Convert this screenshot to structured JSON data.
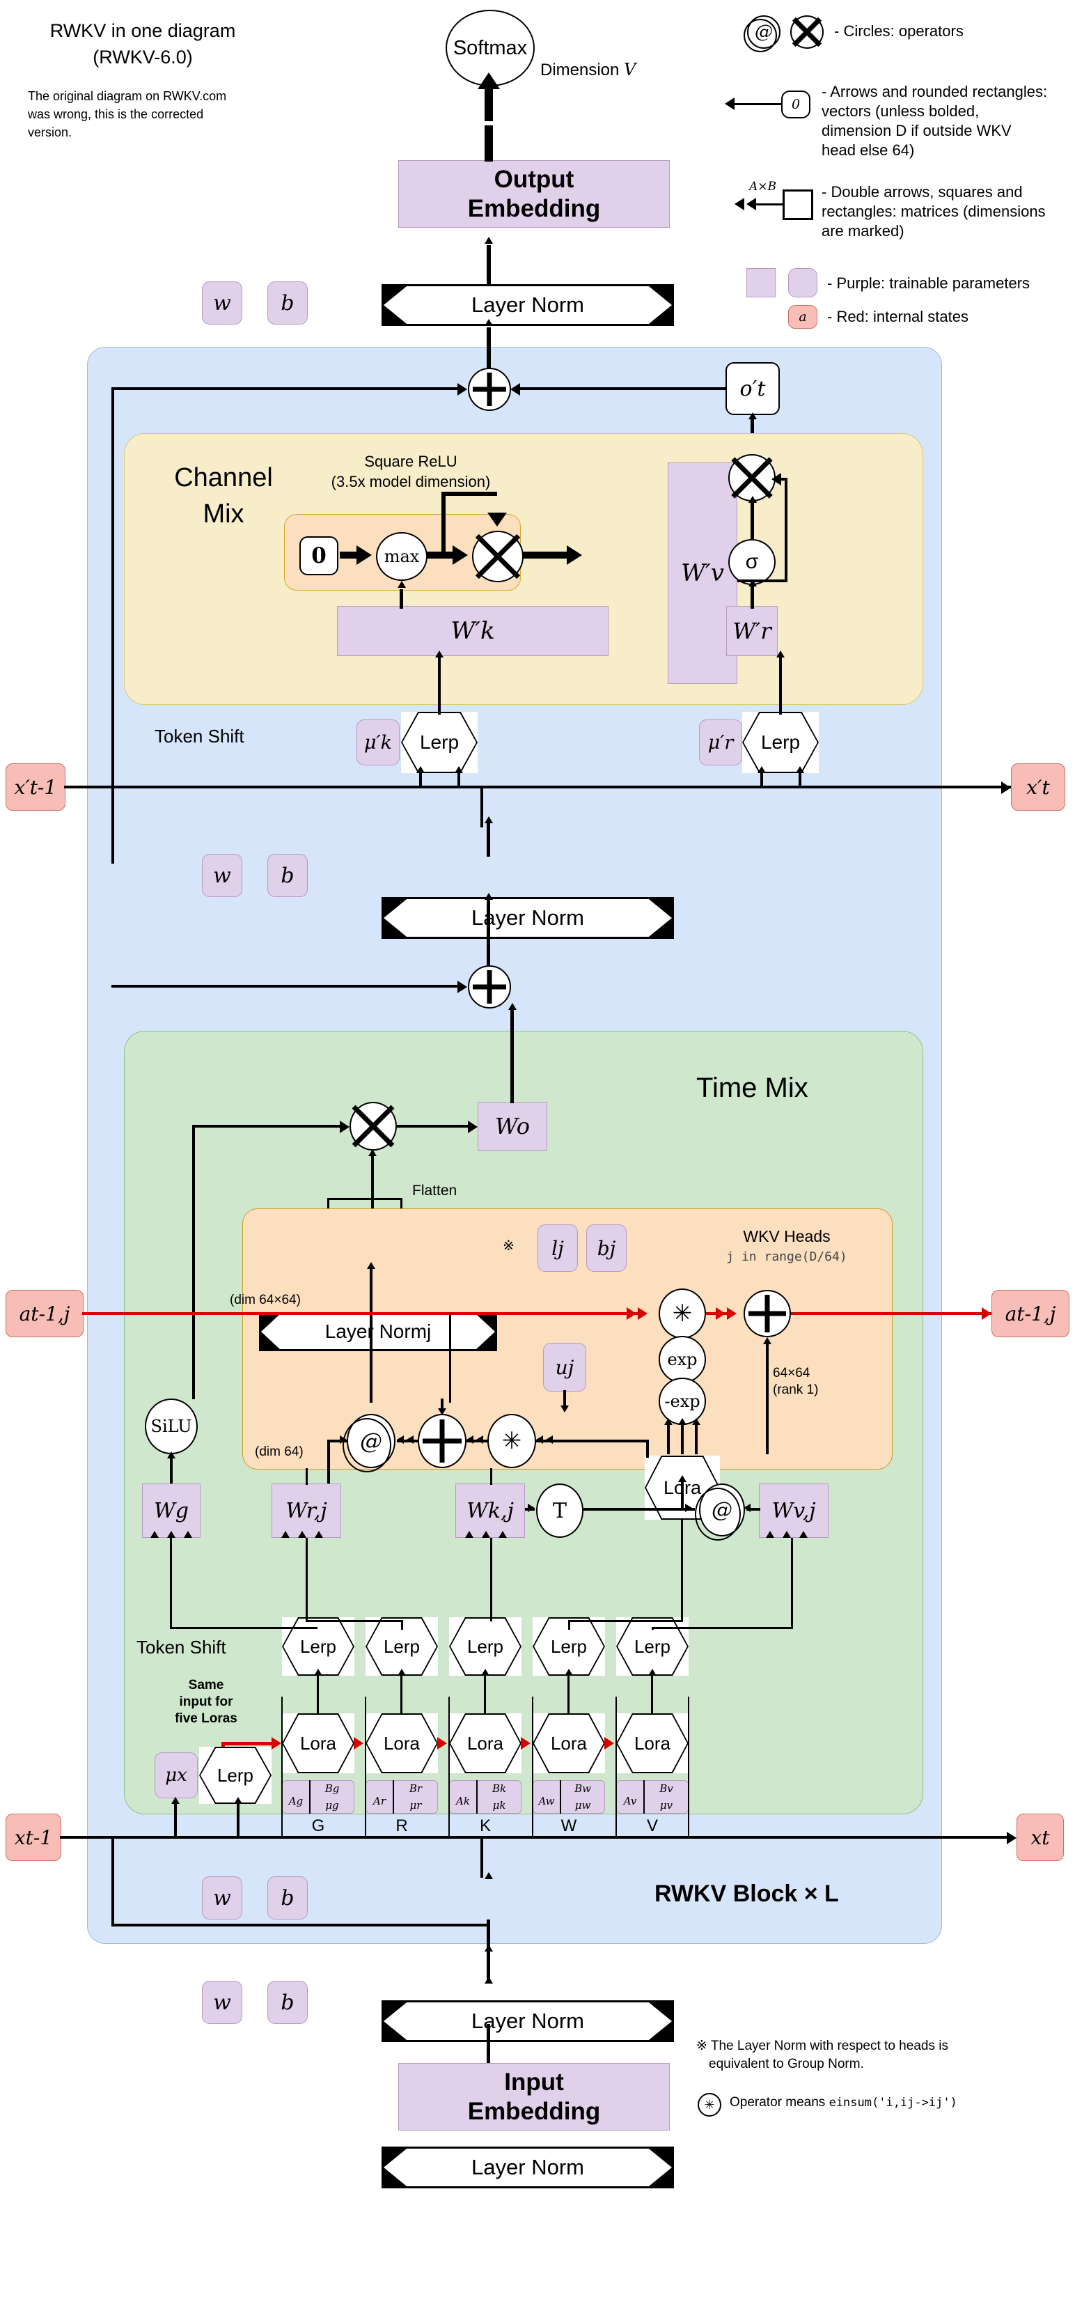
{
  "title": {
    "line1": "RWKV in one diagram",
    "line2": "(RWKV-6.0)"
  },
  "note": {
    "line1": "The original diagram on RWKV.com",
    "line2": "was wrong, this is the corrected",
    "line3": "version."
  },
  "legend": {
    "circles": "- Circles: operators",
    "vectors": "- Arrows and rounded rectangles: vectors (unless bolded, dimension D if outside WKV head else 64)",
    "vectors_lines": [
      "- Arrows and rounded rectangles:",
      "vectors (unless bolded,",
      "dimension D if outside WKV",
      "head else 64)"
    ],
    "vector_box_value": "0",
    "matrices_lines": [
      "- Double arrows, squares and",
      "rectangles: matrices (dimensions",
      "are marked)"
    ],
    "matrix_dim_label": "A×B",
    "purple": "- Purple: trainable parameters",
    "red": "- Red: internal states",
    "red_box_value": "a",
    "at_symbol": "@",
    "times_symbol": "⊗"
  },
  "top": {
    "softmax": "Softmax",
    "dimension_label": "Dimension V",
    "dimension_letter": "V",
    "output_embedding": [
      "Output",
      "Embedding"
    ],
    "layer_norm": "Layer Norm",
    "w": "w",
    "b": "b"
  },
  "channel_mix": {
    "title": [
      "Channel",
      "Mix"
    ],
    "square_relu": "Square ReLU",
    "square_relu_sub": "(3.5x model dimension)",
    "zero": "0",
    "max": "max",
    "times": "⊗",
    "w_v": "W′v",
    "w_k": "W′k",
    "w_r": "W′r",
    "sigma": "σ",
    "token_shift": "Token Shift",
    "mu_k": "μ′k",
    "mu_r": "μ′r",
    "lerp": "Lerp",
    "o_t": "o′t",
    "x_prev": "x′t-1",
    "x_next": "x′t",
    "layer_norm": "Layer Norm",
    "w": "w",
    "b": "b"
  },
  "time_mix": {
    "title": "Time Mix",
    "w_o": "Wo",
    "flatten": "Flatten",
    "layer_norm_j": "Layer Normj",
    "note_mark": "※",
    "l_j": "lj",
    "b_j": "bj",
    "wkv_heads": "WKV Heads",
    "wkv_range": "j in range(D/64)",
    "dim_64x64": "(dim 64×64)",
    "dim_64": "(dim 64)",
    "rank1": "64×64\n(rank 1)",
    "rank1_line1": "64×64",
    "rank1_line2": "(rank 1)",
    "a_prev": "at-1,j",
    "a_next": "at-1,j",
    "u_j": "uj",
    "exp": "exp",
    "neg_exp": "-exp",
    "lora": "Lora",
    "silu": "SiLU",
    "w_g": "Wg",
    "w_rj": "Wr,j",
    "w_kj": "Wk,j",
    "w_vj": "Wv,j",
    "transpose": "T",
    "at_op": "@",
    "plus_op": "⊕",
    "star_op": "✳",
    "token_shift": "Token Shift",
    "lerp": "Lerp",
    "same_input_note": [
      "Same",
      "input for",
      "five Loras"
    ],
    "mu_x": "μx",
    "lerp_main": "Lerp",
    "columns": [
      {
        "key": "G",
        "a": "Ag",
        "b": "Bg",
        "mu": "μg"
      },
      {
        "key": "R",
        "a": "Ar",
        "b": "Br",
        "mu": "μr"
      },
      {
        "key": "K",
        "a": "Ak",
        "b": "Bk",
        "mu": "μk"
      },
      {
        "key": "W",
        "a": "Aw",
        "b": "Bw",
        "mu": "μw"
      },
      {
        "key": "V",
        "a": "Av",
        "b": "Bv",
        "mu": "μv"
      }
    ],
    "x_prev": "xt-1",
    "x_next": "xt",
    "layer_norm": "Layer Norm",
    "w": "w",
    "b": "b"
  },
  "block_label": "RWKV Block × L",
  "bottom": {
    "layer_norm": "Layer Norm",
    "w": "w",
    "b": "b",
    "input_embedding": [
      "Input",
      "Embedding"
    ]
  },
  "footnotes": {
    "n1": "※ The Layer Norm with respect to heads is",
    "n1b": "equivalent to Group Norm.",
    "n2_pre": "Operator means ",
    "n2_code": "einsum('i,ij->ij')",
    "n2_symbol": "✳"
  },
  "colors": {
    "purple": "#e0d0ea",
    "purple_border": "#b59ac4",
    "red": "#f8bdb6",
    "red_border": "#cf6f63",
    "block_blue": "#d6e5fa",
    "channel_yellow": "#f7edc9",
    "time_green": "#cfe8cd",
    "wkv_orange": "#fcdfbf",
    "arrow_red": "#d90000"
  }
}
